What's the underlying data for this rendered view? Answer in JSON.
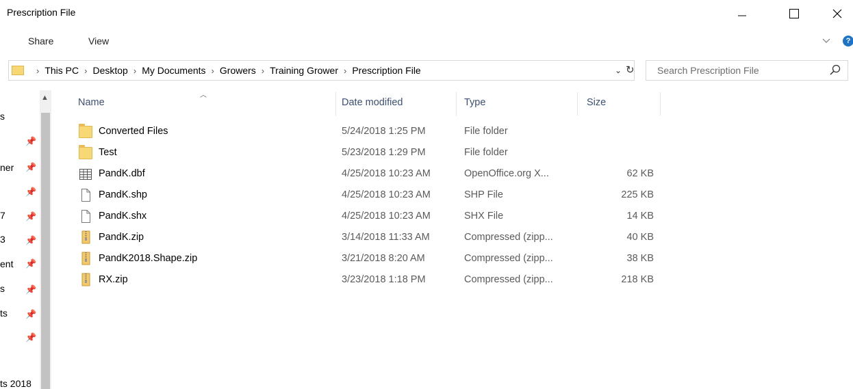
{
  "window": {
    "title": "Prescription File",
    "minimize_icon": "minimize-icon",
    "maximize_icon": "maximize-icon",
    "close_icon": "close-icon"
  },
  "ribbon": {
    "tabs": [
      "Share",
      "View"
    ],
    "help_glyph": "?"
  },
  "address_bar": {
    "crumbs": [
      "This PC",
      "Desktop",
      "My Documents",
      "Growers",
      "Training Grower",
      "Prescription File"
    ],
    "separator": "›",
    "dropdown_glyph": "⌄",
    "refresh_glyph": "↻"
  },
  "search": {
    "placeholder": "Search Prescription File"
  },
  "nav_pane": {
    "fragments": [
      "s",
      "ner",
      "7",
      "3",
      "ent",
      "s",
      "ts",
      "ts 2018"
    ]
  },
  "columns": {
    "name": "Name",
    "date": "Date modified",
    "type": "Type",
    "size": "Size"
  },
  "files": [
    {
      "name": "Converted Files",
      "date": "5/24/2018 1:25 PM",
      "type": "File folder",
      "size": "",
      "icon": "folder-icon"
    },
    {
      "name": "Test",
      "date": "5/23/2018 1:29 PM",
      "type": "File folder",
      "size": "",
      "icon": "folder-icon"
    },
    {
      "name": "PandK.dbf",
      "date": "4/25/2018 10:23 AM",
      "type": "OpenOffice.org X...",
      "size": "62 KB",
      "icon": "spreadsheet-icon"
    },
    {
      "name": "PandK.shp",
      "date": "4/25/2018 10:23 AM",
      "type": "SHP File",
      "size": "225 KB",
      "icon": "file-icon"
    },
    {
      "name": "PandK.shx",
      "date": "4/25/2018 10:23 AM",
      "type": "SHX File",
      "size": "14 KB",
      "icon": "file-icon"
    },
    {
      "name": "PandK.zip",
      "date": "3/14/2018 11:33 AM",
      "type": "Compressed (zipp...",
      "size": "40 KB",
      "icon": "zip-icon"
    },
    {
      "name": "PandK2018.Shape.zip",
      "date": "3/21/2018 8:20 AM",
      "type": "Compressed (zipp...",
      "size": "38 KB",
      "icon": "zip-icon"
    },
    {
      "name": "RX.zip",
      "date": "3/23/2018 1:18 PM",
      "type": "Compressed (zipp...",
      "size": "218 KB",
      "icon": "zip-icon"
    }
  ],
  "colors": {
    "folder": "#f8d775",
    "header_text": "#3c4f74",
    "help_badge": "#1e73c4"
  }
}
